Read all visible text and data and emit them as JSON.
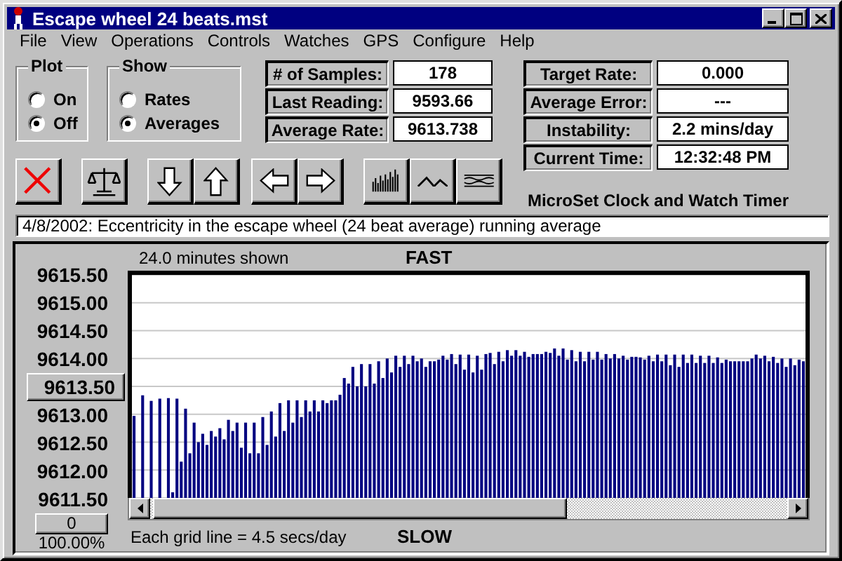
{
  "window": {
    "title": "Escape wheel 24 beats.mst"
  },
  "menu": [
    {
      "label": "File"
    },
    {
      "label": "View"
    },
    {
      "label": "Operations"
    },
    {
      "label": "Controls"
    },
    {
      "label": "Watches"
    },
    {
      "label": "GPS"
    },
    {
      "label": "Configure"
    },
    {
      "label": "Help"
    }
  ],
  "plot_group": {
    "title": "Plot",
    "options": [
      {
        "label": "On",
        "selected": false
      },
      {
        "label": "Off",
        "selected": true
      }
    ]
  },
  "show_group": {
    "title": "Show",
    "options": [
      {
        "label": "Rates",
        "selected": false
      },
      {
        "label": "Averages",
        "selected": true
      }
    ]
  },
  "stats_left": [
    {
      "label": "# of Samples:",
      "value": "178"
    },
    {
      "label": "Last Reading:",
      "value": "9593.66"
    },
    {
      "label": "Average Rate:",
      "value": "9613.738"
    }
  ],
  "stats_right": [
    {
      "label": "Target Rate:",
      "value": "0.000"
    },
    {
      "label": "Average Error:",
      "value": "---"
    },
    {
      "label": "Instability:",
      "value": "2.2 mins/day"
    },
    {
      "label": "Current Time:",
      "value": "12:32:48 PM"
    }
  ],
  "toolbar": [
    {
      "kind": "stop"
    },
    {
      "kind": "scale"
    },
    {
      "kind": "down"
    },
    {
      "kind": "up"
    },
    {
      "kind": "left"
    },
    {
      "kind": "right"
    },
    {
      "kind": "bars"
    },
    {
      "kind": "line"
    },
    {
      "kind": "wave"
    }
  ],
  "app_name": "MicroSet Clock and Watch Timer",
  "note": "4/8/2002: Eccentricity in the escape wheel (24 beat average) running average",
  "graph": {
    "span": "24.0 minutes shown",
    "top_label": "FAST",
    "bottom_label": "SLOW",
    "footer": "Each grid line = 4.5 secs/day",
    "center_button": "9613.50",
    "offset_button": "0",
    "zoom": "100.00%",
    "chart_data": {
      "type": "bar",
      "grid": true,
      "ylim": [
        9611.5,
        9615.5
      ],
      "yticks": [
        {
          "value": 9615.5,
          "label": "9615.50"
        },
        {
          "value": 9615,
          "label": "9615.00"
        },
        {
          "value": 9614.5,
          "label": "9614.50"
        },
        {
          "value": 9614,
          "label": "9614.00"
        },
        {
          "value": 9613,
          "label": "9613.00"
        },
        {
          "value": 9612.5,
          "label": "9612.50"
        },
        {
          "value": 9612,
          "label": "9612.00"
        },
        {
          "value": 9611.5,
          "label": "9611.50"
        }
      ],
      "series": [
        {
          "color": "#000080",
          "values": [
            9612.97,
            9611.5,
            9613.34,
            9611.5,
            9613.24,
            9611.5,
            9613.28,
            9611.5,
            9613.29,
            9611.6,
            9613.28,
            9612.15,
            9613.1,
            9612.3,
            9612.85,
            9612.5,
            9612.65,
            9612.45,
            9612.7,
            9612.6,
            9612.75,
            9612.55,
            9612.9,
            9612.7,
            9612.85,
            9612.4,
            9612.85,
            9612.3,
            9612.85,
            9612.3,
            9612.95,
            9612.45,
            9613.05,
            9612.6,
            9613.2,
            9612.7,
            9613.25,
            9612.85,
            9613.25,
            9612.95,
            9613.25,
            9613.05,
            9613.25,
            9613.05,
            9613.25,
            9613.2,
            9613.25,
            9613.25,
            9613.35,
            9613.65,
            9613.55,
            9613.85,
            9613.5,
            9613.9,
            9613.5,
            9613.9,
            9613.55,
            9613.95,
            9613.65,
            9614.0,
            9613.75,
            9614.05,
            9613.85,
            9614.05,
            9613.9,
            9614.05,
            9613.95,
            9614.0,
            9613.85,
            9613.95,
            9613.95,
            9613.98,
            9614.05,
            9613.98,
            9614.08,
            9613.9,
            9614.07,
            9613.8,
            9614.07,
            9613.75,
            9614.05,
            9613.8,
            9614.08,
            9614.1,
            9613.9,
            9614.12,
            9613.95,
            9614.15,
            9614.05,
            9614.15,
            9614.05,
            9614.12,
            9614.03,
            9614.08,
            9614.08,
            9614.08,
            9614.12,
            9614.1,
            9614.18,
            9614.05,
            9614.18,
            9613.98,
            9614.15,
            9613.95,
            9614.12,
            9613.95,
            9614.12,
            9613.98,
            9614.12,
            9613.98,
            9614.08,
            9614.0,
            9614.08,
            9614.0,
            9614.05,
            9613.98,
            9614.03,
            9614.03,
            9614.02,
            9613.98,
            9614.05,
            9613.95,
            9614.07,
            9613.95,
            9614.07,
            9613.88,
            9614.07,
            9613.85,
            9614.07,
            9613.92,
            9614.07,
            9613.92,
            9614.05,
            9613.92,
            9614.05,
            9613.92,
            9614.02,
            9613.92,
            9613.98,
            9613.95,
            9613.95,
            9613.95,
            9613.95,
            9613.95,
            9614.0,
            9614.07,
            9614.0,
            9614.05,
            9613.95,
            9614.03,
            9613.92,
            9614.0,
            9613.85,
            9614.0,
            9613.88,
            9613.98,
            9613.95
          ]
        }
      ]
    }
  }
}
